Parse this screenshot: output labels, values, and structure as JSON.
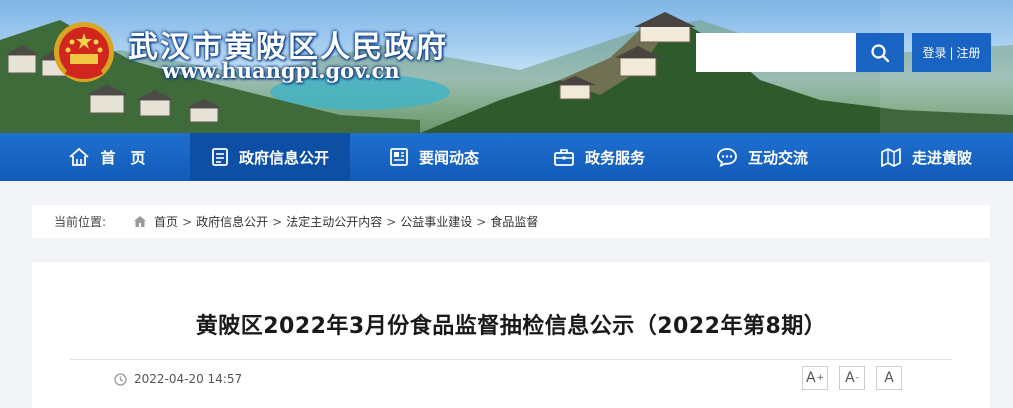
{
  "header": {
    "site_title": "武汉市黄陂区人民政府",
    "site_url": "www.huangpi.gov.cn",
    "search_placeholder": "",
    "login_label": "登录",
    "login_sep": "|",
    "register_label": "注册"
  },
  "nav": {
    "items": [
      {
        "label": "首　页",
        "icon": "home-icon"
      },
      {
        "label": "政府信息公开",
        "icon": "document-icon"
      },
      {
        "label": "要闻动态",
        "icon": "news-icon"
      },
      {
        "label": "政务服务",
        "icon": "briefcase-icon"
      },
      {
        "label": "互动交流",
        "icon": "chat-icon"
      },
      {
        "label": "走进黄陂",
        "icon": "map-icon"
      }
    ],
    "active_index": 1
  },
  "breadcrumb": {
    "label": "当前位置:",
    "items": [
      "首页",
      "政府信息公开",
      "法定主动公开内容",
      "公益事业建设",
      "食品监督"
    ],
    "separator": ">"
  },
  "article": {
    "title": "黄陂区2022年3月份食品监督抽检信息公示（2022年第8期）",
    "datetime": "2022-04-20 14:57",
    "font_buttons": [
      {
        "label": "A",
        "sup": "+"
      },
      {
        "label": "A",
        "sup": "-"
      },
      {
        "label": "A",
        "sup": ""
      }
    ]
  },
  "colors": {
    "nav_bg": "#125bb8",
    "nav_active": "#0d4fa5",
    "search_btn": "#1963c2",
    "page_bg": "#f2f4f7"
  }
}
